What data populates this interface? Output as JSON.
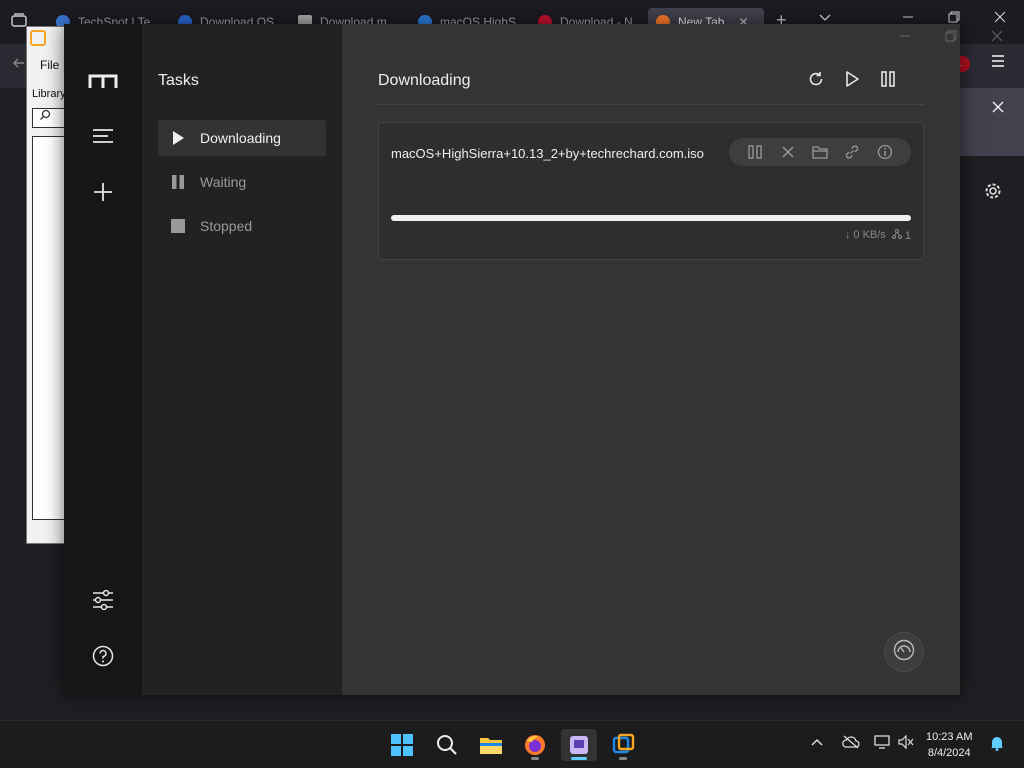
{
  "browser": {
    "tabs": [
      {
        "label": "TechSpot | Te",
        "color": "#3a78d6"
      },
      {
        "label": "Download OS",
        "color": "#2a6ad9"
      },
      {
        "label": "Download m",
        "color": "#aaaaaa"
      },
      {
        "label": "macOS HighS",
        "color": "#2d7ee0"
      },
      {
        "label": "Download - N",
        "color": "#c8102e"
      },
      {
        "label": "New Tab",
        "color": "#ff7b2c"
      }
    ],
    "close_glyph": "✕",
    "new_tab_glyph": "+",
    "ext_badge": "..."
  },
  "vm": {
    "menu_file": "File",
    "library": "Library"
  },
  "app": {
    "nav_title": "Tasks",
    "nav_items": [
      {
        "label": "Downloading"
      },
      {
        "label": "Waiting"
      },
      {
        "label": "Stopped"
      }
    ],
    "main_title": "Downloading",
    "task": {
      "name": "macOS+HighSierra+10.13_2+by+techrechard.com.iso",
      "progress": 1.0,
      "speed": "↓ 0 KB/s",
      "connections": "1"
    }
  },
  "taskbar": {
    "time": "10:23 AM",
    "date": "8/4/2024"
  },
  "colors": {
    "accent": "#60cdff",
    "rail": "#161616",
    "nav": "#222222",
    "main": "#343434"
  }
}
